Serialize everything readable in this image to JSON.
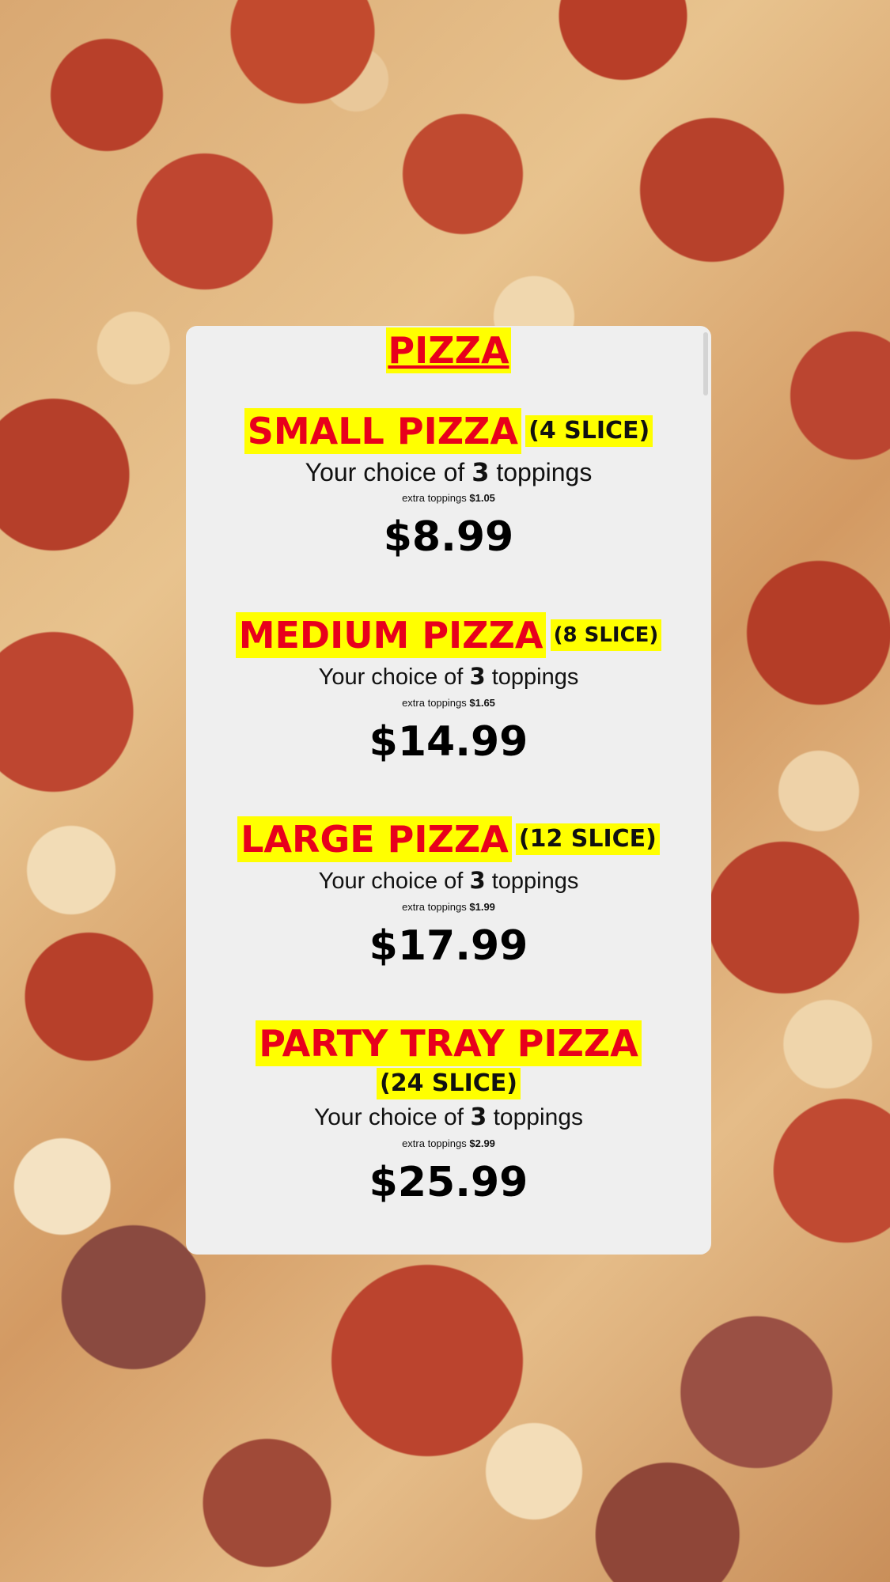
{
  "menu": {
    "title": "PIZZA",
    "items": [
      {
        "name": "SMALL PIZZA",
        "size": "(4 SLICE)",
        "toppings_prefix": "Your choice of",
        "toppings_count": "3",
        "toppings_suffix": "toppings",
        "extra_label": "extra toppings",
        "extra_price": "$1.05",
        "price": "$8.99"
      },
      {
        "name": "MEDIUM PIZZA",
        "size": "(8 SLICE)",
        "toppings_prefix": "Your choice of",
        "toppings_count": "3",
        "toppings_suffix": "toppings",
        "extra_label": "extra toppings",
        "extra_price": "$1.65",
        "price": "$14.99"
      },
      {
        "name": "LARGE PIZZA",
        "size": "(12 SLICE)",
        "toppings_prefix": "Your choice of",
        "toppings_count": "3",
        "toppings_suffix": "toppings",
        "extra_label": "extra toppings",
        "extra_price": "$1.99",
        "price": "$17.99"
      },
      {
        "name": "PARTY TRAY PIZZA",
        "size": "(24 SLICE)",
        "toppings_prefix": "Your choice of",
        "toppings_count": "3",
        "toppings_suffix": "toppings",
        "extra_label": "extra toppings",
        "extra_price": "$2.99",
        "price": "$25.99"
      }
    ]
  },
  "colors": {
    "name_text": "#e8001c",
    "highlight": "#ffff00",
    "panel_background": "#efefef"
  }
}
